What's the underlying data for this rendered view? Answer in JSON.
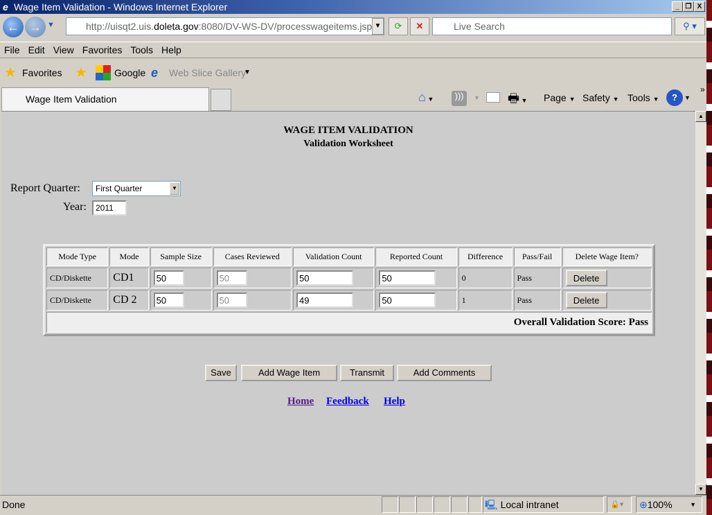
{
  "window": {
    "title": "Wage Item Validation - Windows Internet Explorer"
  },
  "nav": {
    "url_host_pre": "http://uisqt2.uis.",
    "url_host": "doleta.gov",
    "url_rest": ":8080/DV-WS-DV/processwageitems.jsp",
    "search_placeholder": "Live Search"
  },
  "menu": [
    "File",
    "Edit",
    "View",
    "Favorites",
    "Tools",
    "Help"
  ],
  "favorites": {
    "label": "Favorites",
    "google": "Google",
    "webslice": "Web Slice Gallery"
  },
  "tab": {
    "title": "Wage Item Validation"
  },
  "commandbar": {
    "page": "Page",
    "safety": "Safety",
    "tools": "Tools"
  },
  "page": {
    "title": "WAGE ITEM VALIDATION",
    "subtitle": "Validation Worksheet",
    "quarter_label": "Report Quarter:",
    "quarter_value": "First Quarter",
    "year_label": "Year:",
    "year_value": "2011",
    "columns": [
      "Mode Type",
      "Mode",
      "Sample Size",
      "Cases Reviewed",
      "Validation Count",
      "Reported Count",
      "Difference",
      "Pass/Fail",
      "Delete Wage Item?"
    ],
    "rows": [
      {
        "mode_type": "CD/Diskette",
        "mode": "CD1",
        "sample_size": "50",
        "cases_reviewed": "50",
        "validation_count": "50",
        "reported_count": "50",
        "difference": "0",
        "pass_fail": "Pass",
        "delete": "Delete"
      },
      {
        "mode_type": "CD/Diskette",
        "mode": "CD 2",
        "sample_size": "50",
        "cases_reviewed": "50",
        "validation_count": "49",
        "reported_count": "50",
        "difference": "1",
        "pass_fail": "Pass",
        "delete": "Delete"
      }
    ],
    "overall": "Overall Validation Score: Pass",
    "buttons": {
      "save": "Save",
      "add": "Add Wage Item",
      "transmit": "Transmit",
      "comments": "Add Comments"
    },
    "links": {
      "home": "Home",
      "feedback": "Feedback",
      "help": "Help"
    }
  },
  "status": {
    "text": "Done",
    "zone": "Local intranet",
    "zoom": "100%"
  }
}
